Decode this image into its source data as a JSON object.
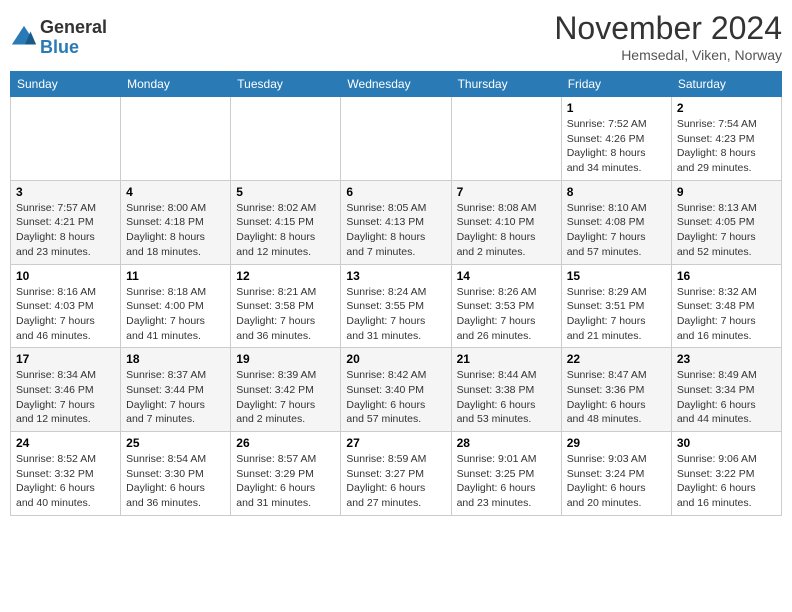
{
  "logo": {
    "general": "General",
    "blue": "Blue"
  },
  "title": "November 2024",
  "location": "Hemsedal, Viken, Norway",
  "headers": [
    "Sunday",
    "Monday",
    "Tuesday",
    "Wednesday",
    "Thursday",
    "Friday",
    "Saturday"
  ],
  "weeks": [
    [
      {
        "day": "",
        "info": ""
      },
      {
        "day": "",
        "info": ""
      },
      {
        "day": "",
        "info": ""
      },
      {
        "day": "",
        "info": ""
      },
      {
        "day": "",
        "info": ""
      },
      {
        "day": "1",
        "info": "Sunrise: 7:52 AM\nSunset: 4:26 PM\nDaylight: 8 hours\nand 34 minutes."
      },
      {
        "day": "2",
        "info": "Sunrise: 7:54 AM\nSunset: 4:23 PM\nDaylight: 8 hours\nand 29 minutes."
      }
    ],
    [
      {
        "day": "3",
        "info": "Sunrise: 7:57 AM\nSunset: 4:21 PM\nDaylight: 8 hours\nand 23 minutes."
      },
      {
        "day": "4",
        "info": "Sunrise: 8:00 AM\nSunset: 4:18 PM\nDaylight: 8 hours\nand 18 minutes."
      },
      {
        "day": "5",
        "info": "Sunrise: 8:02 AM\nSunset: 4:15 PM\nDaylight: 8 hours\nand 12 minutes."
      },
      {
        "day": "6",
        "info": "Sunrise: 8:05 AM\nSunset: 4:13 PM\nDaylight: 8 hours\nand 7 minutes."
      },
      {
        "day": "7",
        "info": "Sunrise: 8:08 AM\nSunset: 4:10 PM\nDaylight: 8 hours\nand 2 minutes."
      },
      {
        "day": "8",
        "info": "Sunrise: 8:10 AM\nSunset: 4:08 PM\nDaylight: 7 hours\nand 57 minutes."
      },
      {
        "day": "9",
        "info": "Sunrise: 8:13 AM\nSunset: 4:05 PM\nDaylight: 7 hours\nand 52 minutes."
      }
    ],
    [
      {
        "day": "10",
        "info": "Sunrise: 8:16 AM\nSunset: 4:03 PM\nDaylight: 7 hours\nand 46 minutes."
      },
      {
        "day": "11",
        "info": "Sunrise: 8:18 AM\nSunset: 4:00 PM\nDaylight: 7 hours\nand 41 minutes."
      },
      {
        "day": "12",
        "info": "Sunrise: 8:21 AM\nSunset: 3:58 PM\nDaylight: 7 hours\nand 36 minutes."
      },
      {
        "day": "13",
        "info": "Sunrise: 8:24 AM\nSunset: 3:55 PM\nDaylight: 7 hours\nand 31 minutes."
      },
      {
        "day": "14",
        "info": "Sunrise: 8:26 AM\nSunset: 3:53 PM\nDaylight: 7 hours\nand 26 minutes."
      },
      {
        "day": "15",
        "info": "Sunrise: 8:29 AM\nSunset: 3:51 PM\nDaylight: 7 hours\nand 21 minutes."
      },
      {
        "day": "16",
        "info": "Sunrise: 8:32 AM\nSunset: 3:48 PM\nDaylight: 7 hours\nand 16 minutes."
      }
    ],
    [
      {
        "day": "17",
        "info": "Sunrise: 8:34 AM\nSunset: 3:46 PM\nDaylight: 7 hours\nand 12 minutes."
      },
      {
        "day": "18",
        "info": "Sunrise: 8:37 AM\nSunset: 3:44 PM\nDaylight: 7 hours\nand 7 minutes."
      },
      {
        "day": "19",
        "info": "Sunrise: 8:39 AM\nSunset: 3:42 PM\nDaylight: 7 hours\nand 2 minutes."
      },
      {
        "day": "20",
        "info": "Sunrise: 8:42 AM\nSunset: 3:40 PM\nDaylight: 6 hours\nand 57 minutes."
      },
      {
        "day": "21",
        "info": "Sunrise: 8:44 AM\nSunset: 3:38 PM\nDaylight: 6 hours\nand 53 minutes."
      },
      {
        "day": "22",
        "info": "Sunrise: 8:47 AM\nSunset: 3:36 PM\nDaylight: 6 hours\nand 48 minutes."
      },
      {
        "day": "23",
        "info": "Sunrise: 8:49 AM\nSunset: 3:34 PM\nDaylight: 6 hours\nand 44 minutes."
      }
    ],
    [
      {
        "day": "24",
        "info": "Sunrise: 8:52 AM\nSunset: 3:32 PM\nDaylight: 6 hours\nand 40 minutes."
      },
      {
        "day": "25",
        "info": "Sunrise: 8:54 AM\nSunset: 3:30 PM\nDaylight: 6 hours\nand 36 minutes."
      },
      {
        "day": "26",
        "info": "Sunrise: 8:57 AM\nSunset: 3:29 PM\nDaylight: 6 hours\nand 31 minutes."
      },
      {
        "day": "27",
        "info": "Sunrise: 8:59 AM\nSunset: 3:27 PM\nDaylight: 6 hours\nand 27 minutes."
      },
      {
        "day": "28",
        "info": "Sunrise: 9:01 AM\nSunset: 3:25 PM\nDaylight: 6 hours\nand 23 minutes."
      },
      {
        "day": "29",
        "info": "Sunrise: 9:03 AM\nSunset: 3:24 PM\nDaylight: 6 hours\nand 20 minutes."
      },
      {
        "day": "30",
        "info": "Sunrise: 9:06 AM\nSunset: 3:22 PM\nDaylight: 6 hours\nand 16 minutes."
      }
    ]
  ]
}
